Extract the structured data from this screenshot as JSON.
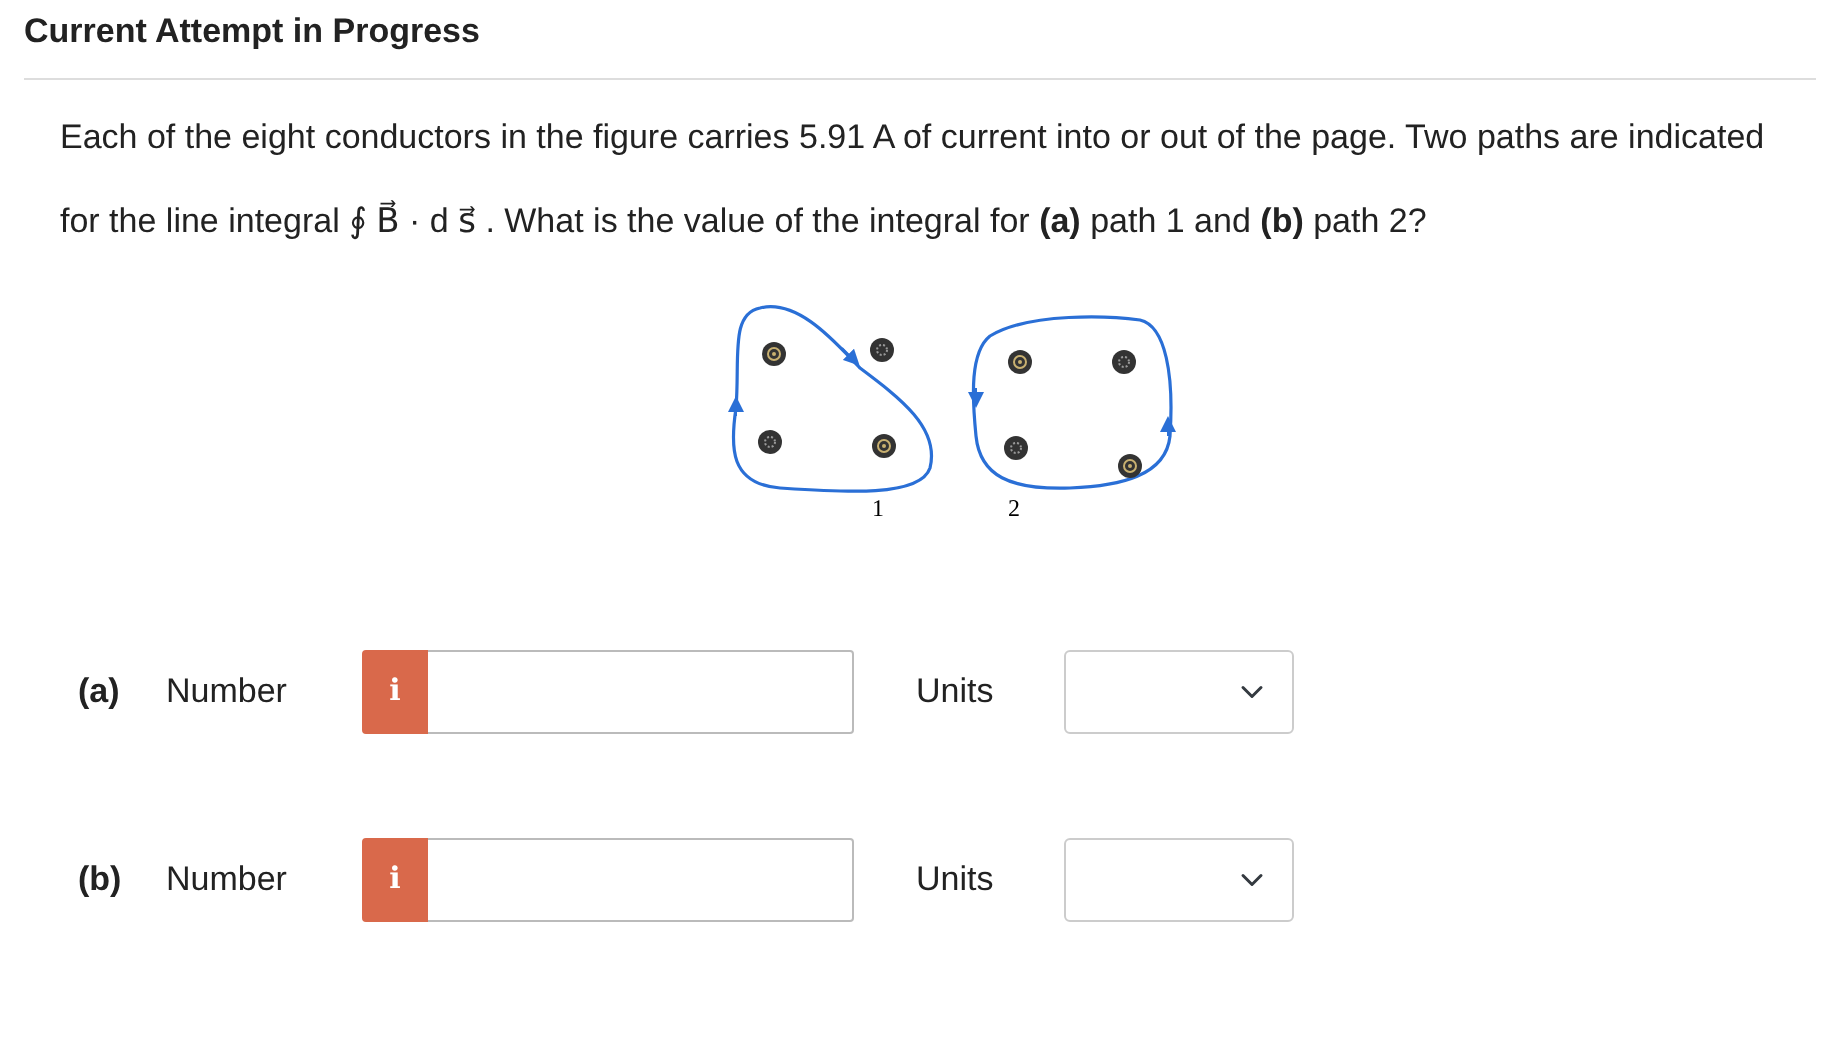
{
  "header": {
    "title": "Current Attempt in Progress"
  },
  "question": {
    "text": "Each of the eight conductors in the figure carries 5.91 A of current into or out of the page. Two paths are indicated for the line integral ∮ B⃗ · d s⃗ . What is the value of the integral for **(a)** path 1 and **(b)** path 2?"
  },
  "figure": {
    "path_labels": [
      "1",
      "2"
    ]
  },
  "answers": [
    {
      "part": "(a)",
      "label": "Number",
      "info_icon": "i",
      "units_label": "Units"
    },
    {
      "part": "(b)",
      "label": "Number",
      "info_icon": "i",
      "units_label": "Units"
    }
  ]
}
